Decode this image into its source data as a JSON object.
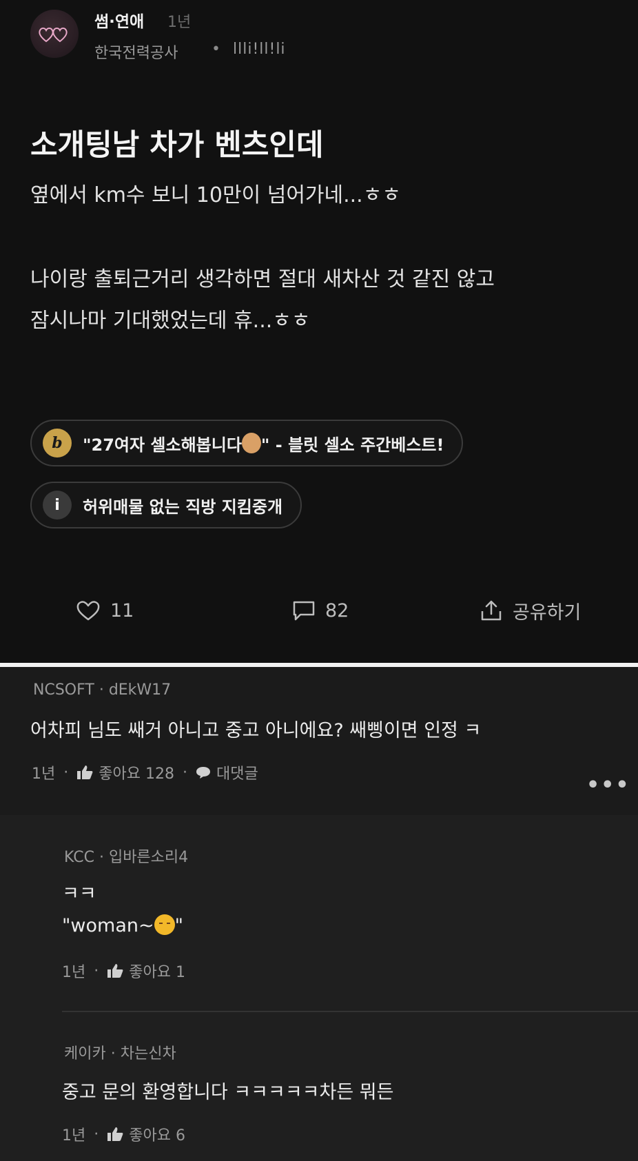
{
  "post": {
    "board": "썸·연애",
    "time": "1년",
    "company": "한국전력공사",
    "separator": "•",
    "nickname": "llli!ll!li",
    "title": "소개팅남 차가 벤츠인데",
    "body_lines": [
      "옆에서 km수 보니 10만이 넘어가네...ㅎㅎ",
      "나이랑 출퇴근거리 생각하면 절대 새차산 것 같진 않고",
      "잠시나마 기대했었는데 휴...ㅎㅎ"
    ],
    "chips": [
      {
        "icon": "b",
        "text_before": "\"27여자 셀소해봅니다",
        "text_after": "\" - 블릿 셀소 주간베스트!"
      },
      {
        "icon": "i",
        "text": "허위매물 없는 직방 지킴중개"
      }
    ],
    "actions": {
      "likes": "11",
      "comments": "82",
      "share": "공유하기"
    }
  },
  "comments": [
    {
      "company": "NCSOFT",
      "nickname": "dEkW17",
      "text": "어차피 님도 쌔거 아니고 중고 아니에요? 쌔삥이면 인정 ㅋ",
      "time": "1년",
      "likes_label": "좋아요 128",
      "reply_label": "대댓글",
      "more": "•••"
    }
  ],
  "replies": [
    {
      "company": "KCC",
      "nickname": "입바른소리4",
      "lines": [
        "ㅋㅋ",
        "\"woman~",
        "\""
      ],
      "time": "1년",
      "likes_label": "좋아요 1"
    },
    {
      "company": "케이카",
      "nickname": "차는신차",
      "text": "중고 문의 환영합니다 ㅋㅋㅋㅋㅋ차든 뭐든",
      "time": "1년",
      "likes_label": "좋아요 6"
    }
  ],
  "meta_sep": "·"
}
